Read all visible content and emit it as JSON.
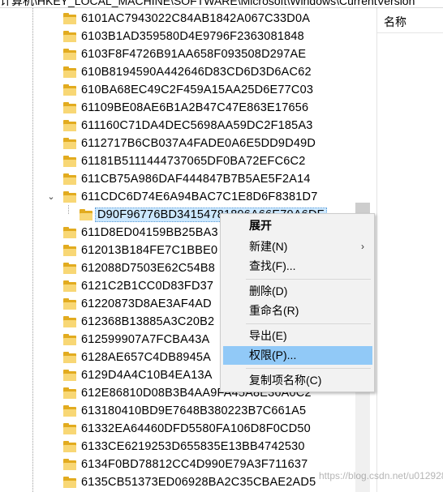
{
  "address_bar": {
    "path": "计算机\\HKEY_LOCAL_MACHINE\\SOFTWARE\\Microsoft\\Windows\\CurrentVersion"
  },
  "tree": {
    "items": [
      "6101AC7943022C84AB1842A067C33D0A",
      "6103B1AD359580D4E9796F2363081848",
      "6103F8F4726B91AA658F093508D297AE",
      "610B8194590A442646D83CD6D3D6AC62",
      "610BA68EC49C2F459A15AA25D6E77C03",
      "61109BE08AE6B1A2B47C47E863E17656",
      "611160C71DA4DEC5698AA59DC2F185A3",
      "6112717B6CB037A4FADE0A6E5DD9D49D",
      "61181B5111444737065DF0BA72EFC6C2",
      "611CB75A986DAF444847B7B5AE5F2A14",
      "611CDC6D74E6A94BAC7C1E8D6F8381D7"
    ],
    "expanded_child": "D90F96776BD34154781896A66E79A6DF",
    "items_after": [
      "611D8ED04159BB25BA3",
      "612013B184FE7C1BBE0",
      "612088D7503E62C54B8",
      "6121C2B1CC0D83FD37",
      "61220873D8AE3AF4AD",
      "612368B13885A3C20B2",
      "612599907A7FCBA43A",
      "6128AE657C4DB8945A",
      "6129D4A4C10B4EA13A",
      "612E86810D08B3B4AA9FA45A8E36A0C2",
      "613180410BD9E7648B380223B7C661A5",
      "61332EA64460DFD5580FA106D8F0CD50",
      "6133CE6219253D655835E13BB4742530",
      "6134F0BD78812CC4D990E79A3F711637",
      "6135CB51373ED06928BA2C35CBAE2AD5"
    ]
  },
  "right_pane": {
    "column_header": "名称"
  },
  "context_menu": {
    "items": [
      {
        "label": "展开",
        "bold": true
      },
      {
        "label": "新建(N)",
        "submenu_arrow": "›"
      },
      {
        "label": "查找(F)..."
      },
      {
        "label": "删除(D)"
      },
      {
        "label": "重命名(R)"
      },
      {
        "label": "导出(E)"
      },
      {
        "label": "权限(P)...",
        "highlighted": true
      },
      {
        "label": "复制项名称(C)"
      }
    ]
  },
  "watermark": "https://blog.csdn.net/u012928587",
  "colors": {
    "folder_front": "#f8d775",
    "folder_back": "#e2ab1f",
    "menu_bg": "#f2f2f2",
    "menu_highlight": "#91c9f7",
    "selection": "#cce8ff"
  },
  "icons": {
    "folder": "folder-icon",
    "expanded": "chevron-down-icon",
    "submenu": "chevron-right-icon"
  }
}
